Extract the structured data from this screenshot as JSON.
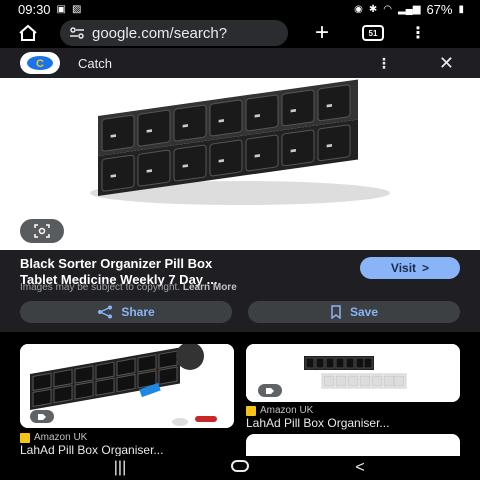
{
  "status": {
    "time": "09:30",
    "battery": "67%"
  },
  "browser": {
    "url": "google.com/search?",
    "tab_count": "51"
  },
  "source_bar": {
    "site_name": "Catch"
  },
  "detail": {
    "title_line1": "Black Sorter Organizer Pill Box",
    "title_line2": "Tablet Medicine Weekly 7 Day ...",
    "visit_label": "Visit",
    "copyright_text": "Images may be subject to copyright.",
    "learn_more": "Learn More",
    "share_label": "Share",
    "save_label": "Save"
  },
  "results": [
    {
      "source": "Amazon UK",
      "title": "LahAd Pill Box Organiser..."
    },
    {
      "source": "Amazon UK",
      "title": "LahAd Pill Box Organiser..."
    }
  ],
  "icons": {
    "home": "home-icon",
    "site_info": "tune-icon",
    "new_tab": "plus-icon",
    "tabs": "tab-switcher-icon",
    "menu": "more-vert-icon",
    "close": "close-icon",
    "lens": "lens-icon",
    "share": "share-icon",
    "save": "bookmark-icon",
    "tag": "tag-icon"
  },
  "colors": {
    "accent": "#8ab4f8",
    "panel": "#1f1f23",
    "button": "#3c4043"
  }
}
